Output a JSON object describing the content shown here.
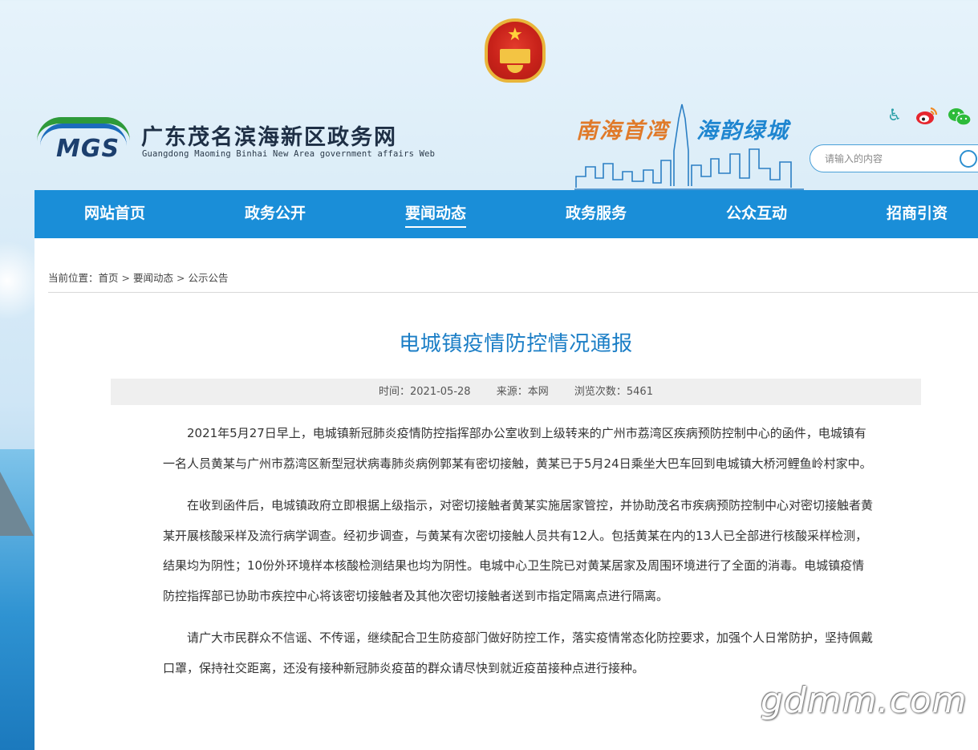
{
  "header": {
    "site_title": "广东茂名滨海新区政务网",
    "site_subtitle": "Guangdong Maoming Binhai New Area government affairs Web",
    "logo_text": "MGS",
    "slogan_part1": "南海首湾",
    "slogan_part2": "海韵绿城",
    "search_placeholder": "请输入的内容"
  },
  "nav": {
    "items": [
      {
        "label": "网站首页"
      },
      {
        "label": "政务公开"
      },
      {
        "label": "要闻动态",
        "active": true
      },
      {
        "label": "政务服务"
      },
      {
        "label": "公众互动"
      },
      {
        "label": "招商引资"
      }
    ]
  },
  "breadcrumb": {
    "prefix": "当前位置：",
    "items": [
      "首页",
      "要闻动态",
      "公示公告"
    ],
    "separator": ">"
  },
  "article": {
    "title": "电城镇疫情防控情况通报",
    "time": "时间：2021-05-28",
    "source": "来源：本网",
    "views": "浏览次数：5461",
    "paragraphs": [
      "2021年5月27日早上，电城镇新冠肺炎疫情防控指挥部办公室收到上级转来的广州市荔湾区疾病预防控制中心的函件，电城镇有一名人员黄某与广州市荔湾区新型冠状病毒肺炎病例郭某有密切接触，黄某已于5月24日乘坐大巴车回到电城镇大桥河鲤鱼岭村家中。",
      "在收到函件后，电城镇政府立即根据上级指示，对密切接触者黄某实施居家管控，并协助茂名市疾病预防控制中心对密切接触者黄某开展核酸采样及流行病学调查。经初步调查，与黄某有次密切接触人员共有12人。包括黄某在内的13人已全部进行核酸采样检测，结果均为阴性；10份外环境样本核酸检测结果也均为阴性。电城中心卫生院已对黄某居家及周围环境进行了全面的消毒。电城镇疫情防控指挥部已协助市疾控中心将该密切接触者及其他次密切接触者送到市指定隔离点进行隔离。",
      "请广大市民群众不信谣、不传谣，继续配合卫生防疫部门做好防控工作，落实疫情常态化防控要求，加强个人日常防护，坚持佩戴口罩，保持社交距离，还没有接种新冠肺炎疫苗的群众请尽快到就近疫苗接种点进行接种。"
    ]
  },
  "watermark": "gdmm.com",
  "colors": {
    "nav_bg": "#1a8ed8",
    "title": "#1b7ec6",
    "slogan_orange": "#e07a2a",
    "slogan_blue": "#1f86d0"
  },
  "icons": [
    "national-emblem-icon",
    "accessibility-icon",
    "weibo-icon",
    "wechat-icon",
    "search-icon"
  ]
}
